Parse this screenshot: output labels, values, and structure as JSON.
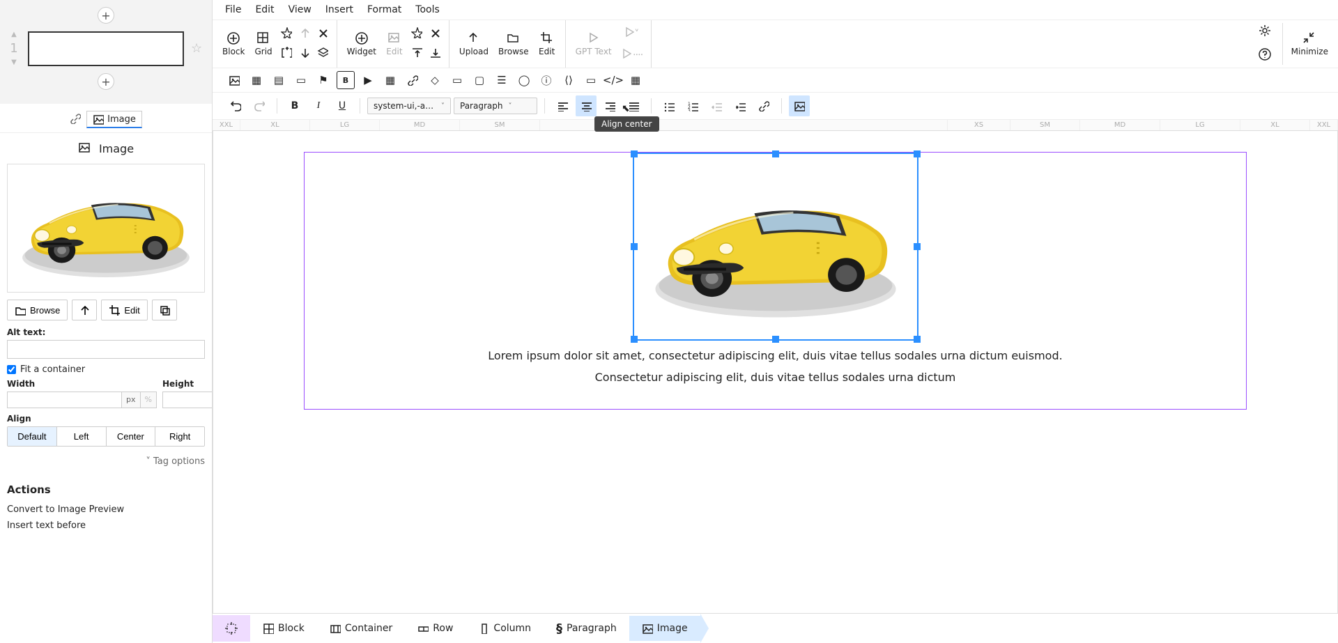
{
  "menu": {
    "file": "File",
    "edit": "Edit",
    "view": "View",
    "insert": "Insert",
    "format": "Format",
    "tools": "Tools"
  },
  "toolbar1": {
    "block": "Block",
    "grid": "Grid",
    "widget": "Widget",
    "edit": "Edit",
    "upload": "Upload",
    "browse": "Browse",
    "edit2": "Edit",
    "gpt": "GPT Text",
    "minimize": "Minimize"
  },
  "toolbar3": {
    "font": "system-ui,-ap…",
    "style": "Paragraph",
    "tooltip": "Align center"
  },
  "ruler": {
    "xxl1": "XXL",
    "xl1": "XL",
    "lg1": "LG",
    "md1": "MD",
    "sm1": "SM",
    "xs": "XS",
    "sm2": "SM",
    "md2": "MD",
    "lg2": "LG",
    "xl2": "XL",
    "xxl2": "XXL"
  },
  "left": {
    "slideNum": "1",
    "tab": "Image",
    "sectionTitle": "Image",
    "browse": "Browse",
    "edit": "Edit",
    "altLabel": "Alt text:",
    "altValue": "",
    "fit": "Fit a container",
    "widthLabel": "Width",
    "heightLabel": "Height",
    "widthVal": "",
    "heightVal": "",
    "px": "px",
    "pct": "%",
    "alignLabel": "Align",
    "align": {
      "default": "Default",
      "left": "Left",
      "center": "Center",
      "right": "Right"
    },
    "tagOptions": "Tag options",
    "actions": "Actions",
    "convert": "Convert to Image Preview",
    "insertBefore": "Insert text before"
  },
  "canvas": {
    "p1": "Lorem ipsum dolor sit amet, consectetur adipiscing elit, duis vitae tellus sodales urna dictum euismod.",
    "p2": "Consectetur adipiscing elit, duis vitae tellus sodales urna dictum"
  },
  "breadcrumb": {
    "block": "Block",
    "container": "Container",
    "row": "Row",
    "column": "Column",
    "paragraph": "Paragraph",
    "image": "Image"
  }
}
